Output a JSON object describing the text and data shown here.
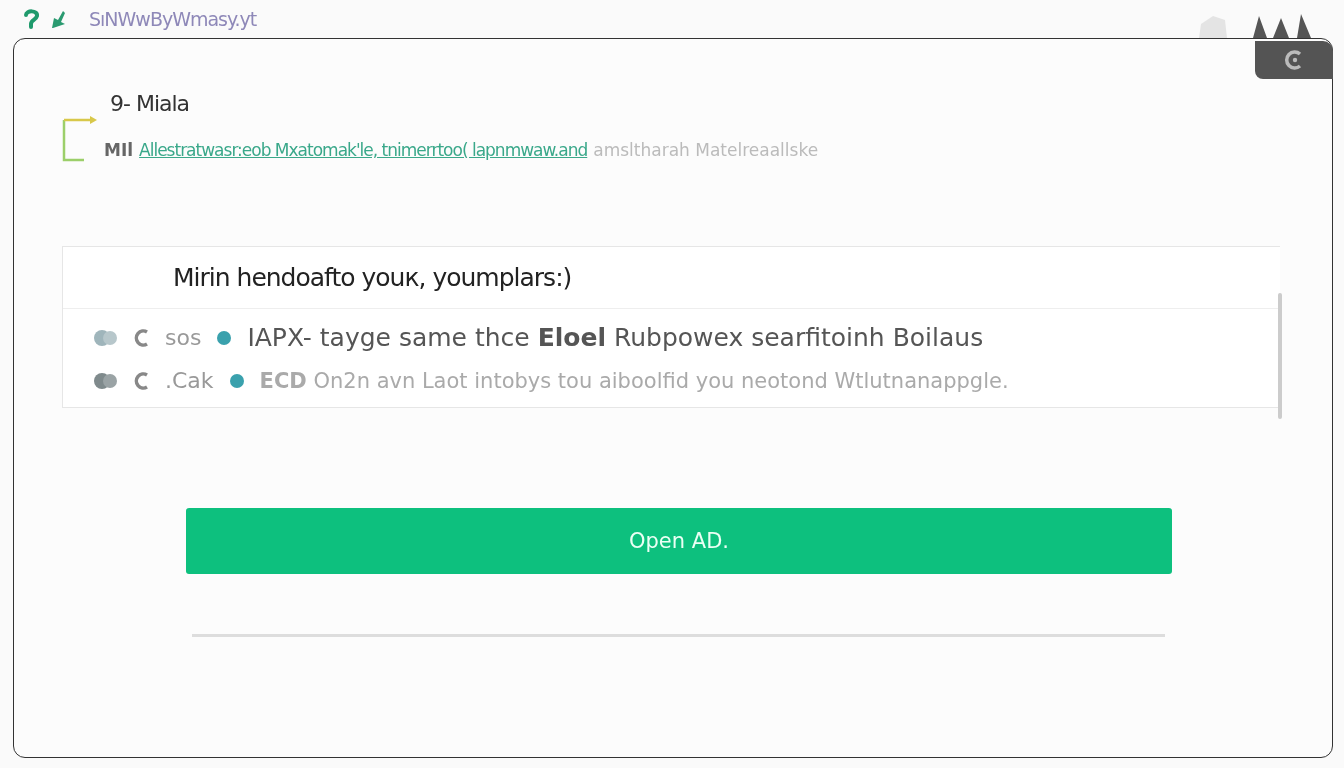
{
  "top_bar": {
    "site": "SıNWwByWmasy.yt"
  },
  "dialog": {
    "title": "9- Miala",
    "description": {
      "label": "MIl",
      "link": "Allestratwasr:eob Mxatomak'le, tnimerrtoo( lapnmwaw.and",
      "text": "amsltharah Matelreaallske"
    },
    "panel": {
      "heading": "Mirin hendoafto youк, youmplars:)",
      "rows": [
        {
          "prefix": "sos",
          "text": "IAPX- tayge same thce **Eloel** Rubpowex searfitoinh Boilaus",
          "muted": false
        },
        {
          "prefix": ".Cak",
          "text": "**ECD** On2n avn Laot intobys tou aiboolfid you neotond  Wtlutnanappgle.",
          "muted": true
        }
      ]
    },
    "button": "Open AD."
  }
}
